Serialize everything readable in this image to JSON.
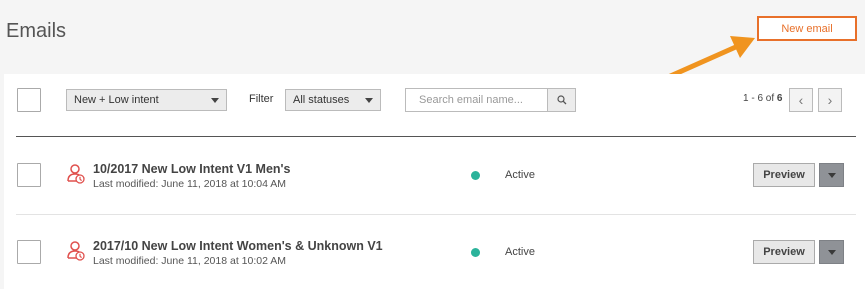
{
  "page": {
    "title": "Emails"
  },
  "toolbar": {
    "new_email_label": "New email",
    "audience_select": "New + Low intent",
    "filter_label": "Filter",
    "status_select": "All statuses",
    "search_placeholder": "Search email name..."
  },
  "pagination": {
    "range": "1 - 6 of ",
    "total": "6"
  },
  "emails": [
    {
      "name": "10/2017 New Low Intent V1 Men's",
      "modified": "Last modified: June 11, 2018 at 10:04 AM",
      "status": "Active",
      "preview_label": "Preview"
    },
    {
      "name": "2017/10 New Low Intent Women's & Unknown V1",
      "modified": "Last modified: June 11, 2018 at 10:02 AM",
      "status": "Active",
      "preview_label": "Preview"
    }
  ],
  "colors": {
    "accent": "#e8702a",
    "active": "#2bb39b",
    "arrow": "#f0941f"
  },
  "icons": [
    "search-icon",
    "chevron-left-icon",
    "chevron-right-icon",
    "person-email-icon",
    "caret-down-icon"
  ]
}
